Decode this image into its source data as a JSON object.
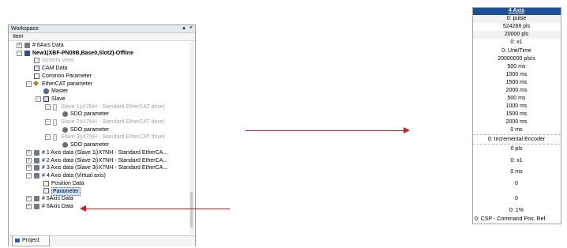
{
  "workspace": {
    "title": "Workspace",
    "pin": "▲",
    "close": "×",
    "column_header": "Item",
    "tab_label": "Project"
  },
  "tree": [
    {
      "label": "# 6Axis Data",
      "icon": "axis-data-icon",
      "style": "normal",
      "expander": "+"
    },
    {
      "label": "New1(XBF-PN08B,Base0,Slot2)-Offline",
      "icon": "module-icon",
      "style": "bold",
      "expander": "−"
    },
    {
      "label": "System View",
      "icon": "system-view-icon",
      "style": "gray",
      "expander": ""
    },
    {
      "label": "CAM Data",
      "icon": "cam-data-icon",
      "style": "normal",
      "expander": ""
    },
    {
      "label": "Common Parameter",
      "icon": "common-parameter-icon",
      "style": "normal",
      "expander": ""
    },
    {
      "label": "EtherCAT parameter",
      "icon": "ethercat-icon",
      "style": "normal",
      "expander": "−"
    },
    {
      "label": "Master",
      "icon": "master-icon",
      "style": "normal",
      "expander": ""
    },
    {
      "label": "Slave",
      "icon": "slave-folder-icon",
      "style": "normal",
      "expander": "−"
    },
    {
      "label": "Slave 1(iX7NH - Standard EtherCAT drive)",
      "icon": "slave-device-icon",
      "style": "gray",
      "expander": "−"
    },
    {
      "label": "SDO parameter",
      "icon": "sdo-parameter-icon",
      "style": "normal",
      "expander": ""
    },
    {
      "label": "Slave 2(iX7NH - Standard EtherCAT drive)",
      "icon": "slave-device-icon",
      "style": "gray",
      "expander": "−"
    },
    {
      "label": "SDO parameter",
      "icon": "sdo-parameter-icon",
      "style": "normal",
      "expander": ""
    },
    {
      "label": "Slave 3(iX7NH - Standard EtherCAT drive)",
      "icon": "slave-device-icon",
      "style": "gray",
      "expander": "−"
    },
    {
      "label": "SDO parameter",
      "icon": "sdo-parameter-icon",
      "style": "normal",
      "expander": ""
    },
    {
      "label": "# 1 Axis data (Slave 1(iX7NH - Standard EtherCA...",
      "icon": "axis-data-icon",
      "style": "normal",
      "expander": "+"
    },
    {
      "label": "# 2 Axis data (Slave 2(iX7NH - Standard EtherCA...",
      "icon": "axis-data-icon",
      "style": "normal",
      "expander": "+"
    },
    {
      "label": "# 3 Axis data (Slave 3(iX7NH - Standard EtherCA...",
      "icon": "axis-data-icon",
      "style": "normal",
      "expander": "+"
    },
    {
      "label": "# 4 Axis data (Virtual axis)",
      "icon": "axis-data-icon",
      "style": "normal",
      "expander": "−"
    },
    {
      "label": "Position Data",
      "icon": "position-data-icon",
      "style": "normal",
      "expander": ""
    },
    {
      "label": "Parameter",
      "icon": "parameter-icon",
      "style": "selected",
      "expander": ""
    },
    {
      "label": "# 5Axis Data",
      "icon": "axis-data-icon",
      "style": "normal",
      "expander": "+"
    },
    {
      "label": "# 6Axis Data",
      "icon": "axis-data-icon",
      "style": "normal",
      "expander": "+"
    }
  ],
  "param_grid": {
    "header": "4 Axis",
    "header_color": "#1c4f9c",
    "rows": [
      {
        "value": "0: pulse",
        "shade": "alt"
      },
      {
        "value": "524288 pls",
        "shade": "white"
      },
      {
        "value": "20000 pls",
        "shade": "alt"
      },
      {
        "value": "0: x1",
        "shade": "white"
      },
      {
        "value": "0: Unit/Time",
        "shade": "white"
      },
      {
        "value": "20000000 pls/s",
        "shade": "white"
      },
      {
        "value": "500 ms",
        "shade": "white"
      },
      {
        "value": "1000 ms",
        "shade": "white"
      },
      {
        "value": "1500 ms",
        "shade": "white"
      },
      {
        "value": "2000 ms",
        "shade": "white"
      },
      {
        "value": "500 ms",
        "shade": "white"
      },
      {
        "value": "1000 ms",
        "shade": "white"
      },
      {
        "value": "1500 ms",
        "shade": "white"
      },
      {
        "value": "2000 ms",
        "shade": "white"
      },
      {
        "value": "0 ms",
        "shade": "white"
      },
      {
        "value": "0: Incremental Encoder",
        "shade": "white"
      },
      {
        "value": "0 pls",
        "shade": "white"
      },
      {
        "value": "0: x1",
        "shade": "white"
      },
      {
        "value": "0 ms",
        "shade": "white"
      },
      {
        "value": "0",
        "shade": "white"
      },
      {
        "value": "0",
        "shade": "white"
      },
      {
        "value": "0: 1%",
        "shade": "white"
      },
      {
        "value": "0: CSP - Command Pos. Ref.",
        "shade": "white"
      }
    ]
  },
  "annotation_color": "#d31919"
}
